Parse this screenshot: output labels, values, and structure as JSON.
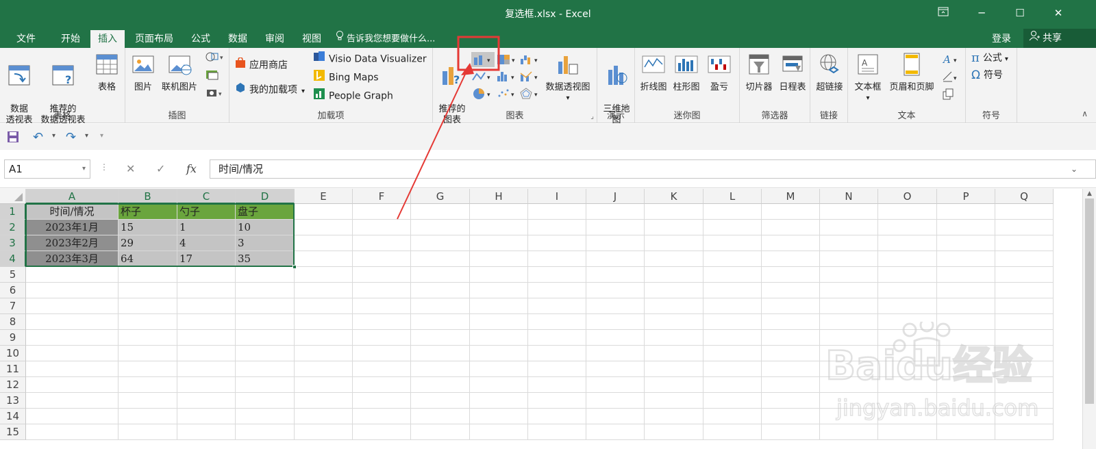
{
  "window": {
    "title": "复选框.xlsx - Excel"
  },
  "menu": {
    "tabs": [
      "文件",
      "开始",
      "插入",
      "页面布局",
      "公式",
      "数据",
      "审阅",
      "视图"
    ],
    "tell_me": "告诉我您想要做什么...",
    "login": "登录",
    "share": "共享"
  },
  "ribbon": {
    "groups": {
      "tables": {
        "label": "表格",
        "pivot": "数据\n透视表",
        "recommended_pivot": "推荐的\n数据透视表",
        "table": "表格"
      },
      "illustrations": {
        "label": "插图",
        "pictures": "图片",
        "online_pictures": "联机图片"
      },
      "addins": {
        "label": "加载项",
        "store": "应用商店",
        "my_addins": "我的加载项",
        "visio": "Visio Data Visualizer",
        "bing": "Bing Maps",
        "people": "People Graph"
      },
      "charts": {
        "label": "图表",
        "recommended": "推荐的\n图表",
        "pivot_chart": "数据透视图"
      },
      "tours": {
        "label": "演示",
        "map3d": "三维地\n图"
      },
      "sparklines": {
        "label": "迷你图",
        "line": "折线图",
        "column": "柱形图",
        "winloss": "盈亏"
      },
      "filters": {
        "label": "筛选器",
        "slicer": "切片器",
        "timeline": "日程表"
      },
      "links": {
        "label": "链接",
        "hyperlink": "超链接"
      },
      "text": {
        "label": "文本",
        "textbox": "文本框",
        "header_footer": "页眉和页脚"
      },
      "symbols": {
        "label": "符号",
        "equation": "公式",
        "symbol": "符号"
      }
    }
  },
  "formula_bar": {
    "name_box": "A1",
    "content": "时间/情况"
  },
  "sheet": {
    "columns": [
      "A",
      "B",
      "C",
      "D",
      "E",
      "F",
      "G",
      "H",
      "I",
      "J",
      "K",
      "L",
      "M",
      "N",
      "O",
      "P",
      "Q"
    ],
    "rows": [
      "1",
      "2",
      "3",
      "4",
      "5",
      "6",
      "7",
      "8",
      "9",
      "10",
      "11",
      "12",
      "13",
      "14",
      "15"
    ],
    "table": {
      "header": [
        "时间/情况",
        "杯子",
        "勺子",
        "盘子"
      ],
      "body": [
        [
          "2023年1月",
          "15",
          "1",
          "10"
        ],
        [
          "2023年2月",
          "29",
          "4",
          "3"
        ],
        [
          "2023年3月",
          "64",
          "17",
          "35"
        ]
      ]
    }
  },
  "watermark": {
    "brand": "Baidu经验",
    "url": "jingyan.baidu.com"
  },
  "colors": {
    "accent": "#217346",
    "header_fill": "#6aa53d",
    "highlight": "#e53935"
  }
}
